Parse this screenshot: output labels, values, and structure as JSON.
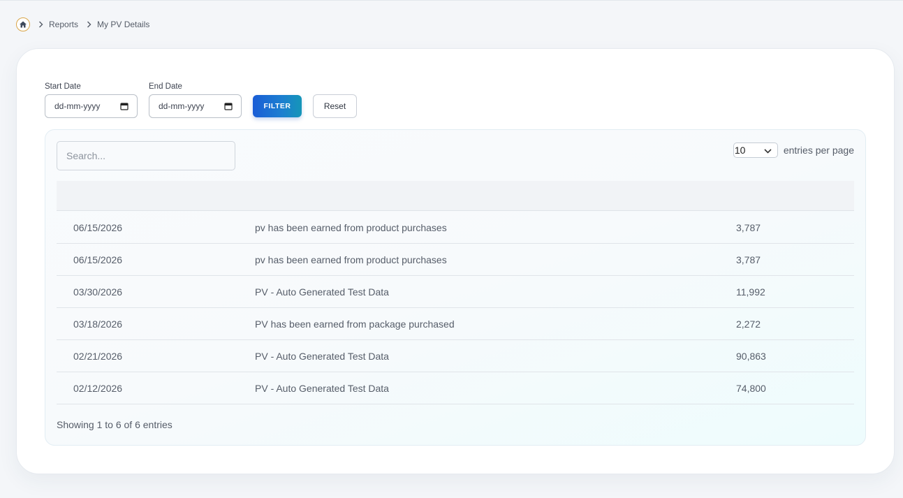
{
  "breadcrumb": {
    "items": [
      "Reports",
      "My PV Details"
    ]
  },
  "filters": {
    "start_label": "Start Date",
    "start_placeholder": "dd-mm-yyyy",
    "end_label": "End Date",
    "end_placeholder": "dd-mm-yyyy",
    "filter_label": "FILTER",
    "reset_label": "Reset"
  },
  "table": {
    "search_placeholder": "Search...",
    "per_page_value": "10",
    "per_page_text": "entries per page",
    "rows": [
      {
        "date": "06/15/2026",
        "description": "pv has been earned from product purchases",
        "pv": "3,787"
      },
      {
        "date": "06/15/2026",
        "description": "pv has been earned from product purchases",
        "pv": "3,787"
      },
      {
        "date": "03/30/2026",
        "description": "PV - Auto Generated Test Data",
        "pv": "11,992"
      },
      {
        "date": "03/18/2026",
        "description": "PV has been earned from package purchased",
        "pv": "2,272"
      },
      {
        "date": "02/21/2026",
        "description": "PV - Auto Generated Test Data",
        "pv": "90,863"
      },
      {
        "date": "02/12/2026",
        "description": "PV - Auto Generated Test Data",
        "pv": "74,800"
      }
    ],
    "showing_text": "Showing 1 to 6 of 6 entries"
  },
  "colors": {
    "accent": "#1a5dd6",
    "home_ring": "#d9a548"
  }
}
